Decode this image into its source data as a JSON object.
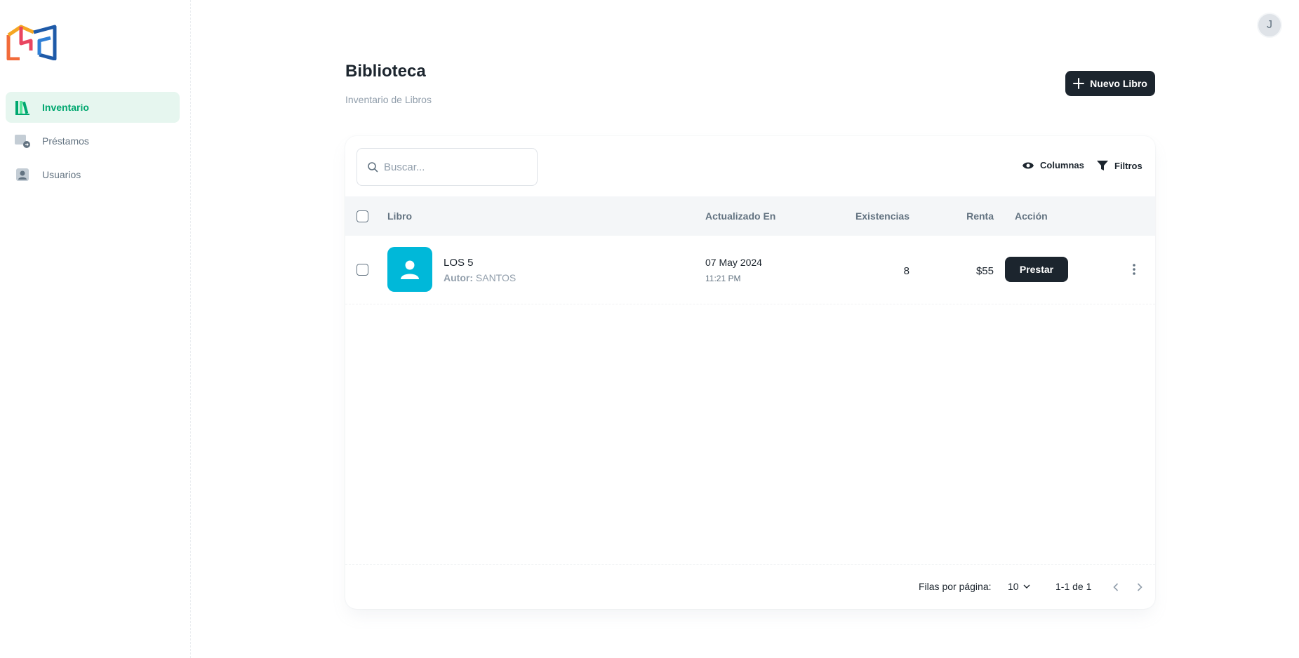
{
  "sidebar": {
    "items": [
      {
        "label": "Inventario",
        "icon": "books-icon",
        "active": true
      },
      {
        "label": "Préstamos",
        "icon": "loan-icon",
        "active": false
      },
      {
        "label": "Usuarios",
        "icon": "user-icon",
        "active": false
      }
    ]
  },
  "user": {
    "avatar_initial": "J"
  },
  "header": {
    "title": "Biblioteca",
    "subtitle": "Inventario de Libros",
    "new_button_label": "Nuevo Libro"
  },
  "toolbar": {
    "search_placeholder": "Buscar...",
    "columns_label": "Columnas",
    "filters_label": "Filtros"
  },
  "table": {
    "columns": [
      "Libro",
      "Actualizado En",
      "Existencias",
      "Renta",
      "Acción"
    ],
    "rows": [
      {
        "title": "LOS 5",
        "author_label": "Autor:",
        "author": "SANTOS",
        "date": "07 May 2024",
        "time": "11:21 PM",
        "stock": "8",
        "rent": "$55",
        "action_label": "Prestar"
      }
    ]
  },
  "pagination": {
    "rows_per_page_label": "Filas por página:",
    "rows_per_page": "10",
    "range": "1-1 de 1"
  },
  "colors": {
    "accent": "#00a76f",
    "dark": "#1c252e",
    "cover": "#00b8d9"
  }
}
